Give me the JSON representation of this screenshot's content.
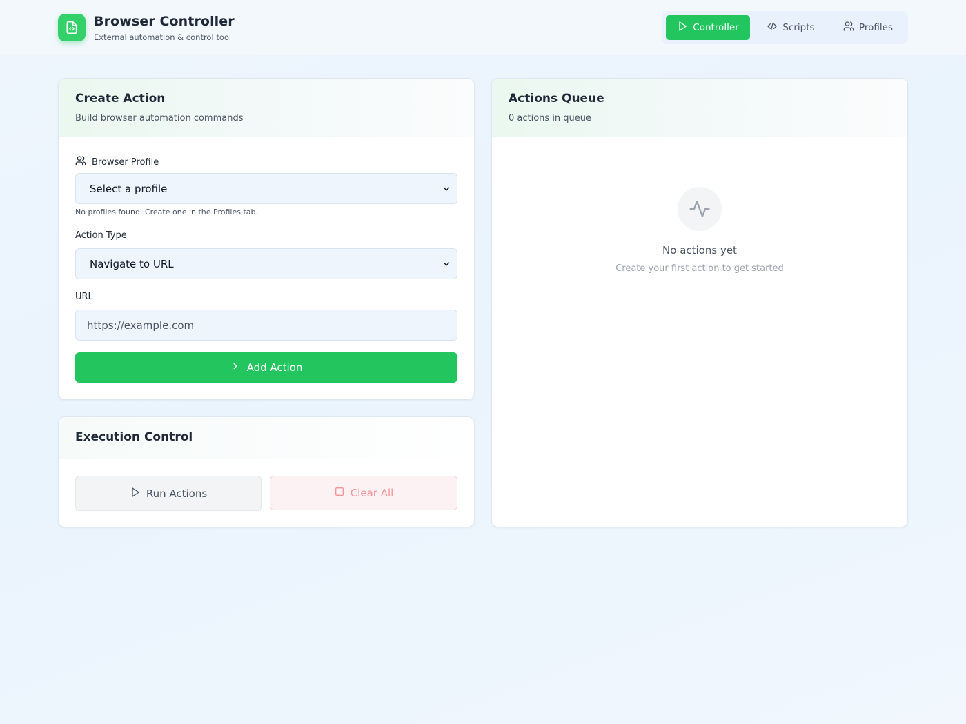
{
  "header": {
    "title": "Browser Controller",
    "subtitle": "External automation & control tool",
    "logo_icon": "code-file-icon"
  },
  "nav": {
    "tabs": [
      {
        "label": "Controller",
        "icon": "play-icon",
        "active": true
      },
      {
        "label": "Scripts",
        "icon": "code-icon",
        "active": false
      },
      {
        "label": "Profiles",
        "icon": "users-icon",
        "active": false
      }
    ]
  },
  "create_action": {
    "title": "Create Action",
    "subtitle": "Build browser automation commands",
    "profile_label": "Browser Profile",
    "profile_value": "Select a profile",
    "profile_hint": "No profiles found. Create one in the Profiles tab.",
    "action_type_label": "Action Type",
    "action_type_value": "Navigate to URL",
    "url_label": "URL",
    "url_placeholder": "https://example.com",
    "add_button": "Add Action"
  },
  "execution": {
    "title": "Execution Control",
    "run_button": "Run Actions",
    "clear_button": "Clear All"
  },
  "queue": {
    "title": "Actions Queue",
    "count_text": "0 actions in queue",
    "empty_title": "No actions yet",
    "empty_subtitle": "Create your first action to get started",
    "empty_icon": "activity-icon"
  },
  "colors": {
    "accent": "#22c55e",
    "danger_text": "#f3949b"
  }
}
